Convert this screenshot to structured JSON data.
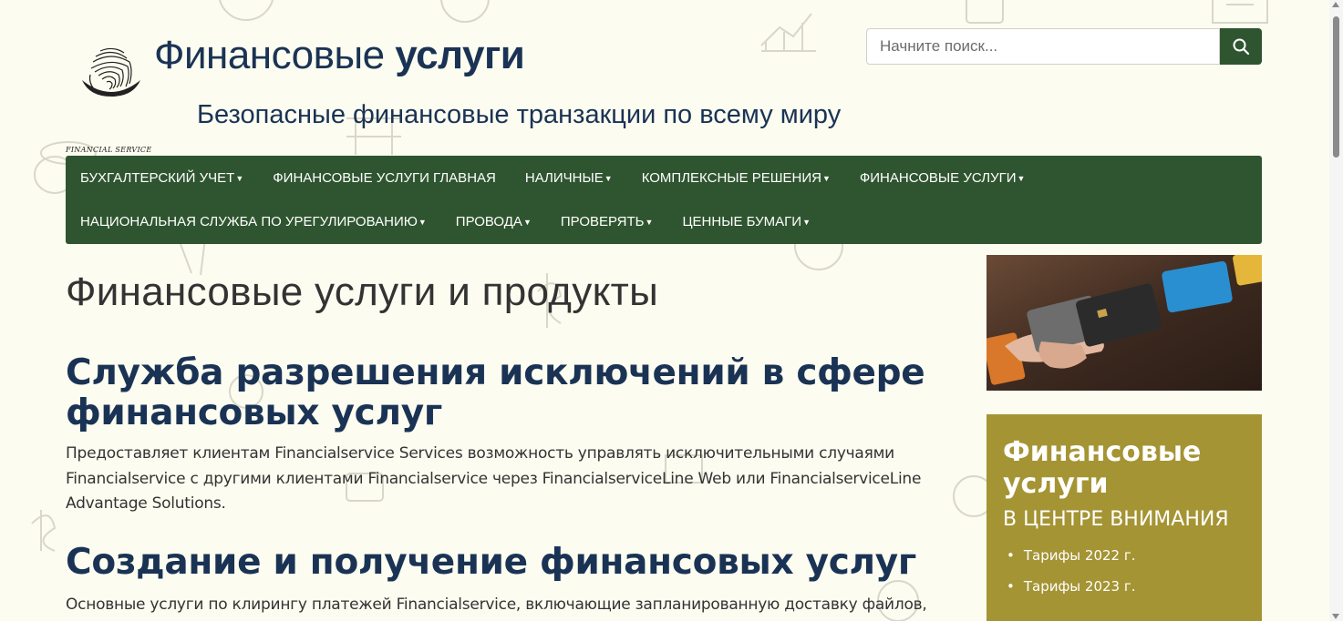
{
  "header": {
    "logo_caption": "FINANCIAL SERVICE",
    "title_regular": "Финансовые ",
    "title_bold": "услуги",
    "tagline": "Безопасные финансовые транзакции по всему миру"
  },
  "search": {
    "placeholder": "Начните поиск...",
    "icon": "search-icon"
  },
  "nav": {
    "row1": [
      {
        "label": "БУХГАЛТЕРСКИЙ УЧЕТ",
        "dropdown": true
      },
      {
        "label": "ФИНАНСОВЫЕ УСЛУГИ ГЛАВНАЯ",
        "dropdown": false
      },
      {
        "label": "НАЛИЧНЫЕ",
        "dropdown": true
      },
      {
        "label": "КОМПЛЕКСНЫЕ РЕШЕНИЯ",
        "dropdown": true
      },
      {
        "label": "ФИНАНСОВЫЕ УСЛУГИ",
        "dropdown": true
      }
    ],
    "row2": [
      {
        "label": "НАЦИОНАЛЬНАЯ СЛУЖБА ПО УРЕГУЛИРОВАНИЮ",
        "dropdown": true
      },
      {
        "label": "ПРОВОДА",
        "dropdown": true
      },
      {
        "label": "ПРОВЕРЯТЬ",
        "dropdown": true
      },
      {
        "label": "ЦЕННЫЕ БУМАГИ",
        "dropdown": true
      }
    ]
  },
  "main": {
    "title": "Финансовые услуги и продукты",
    "section1": {
      "heading": "Служба разрешения исключений в сфере финансовых услуг",
      "text": "Предоставляет клиентам Financialservice Services возможность управлять исключительными случаями Financialservice с другими клиентами Financialservice через FinancialserviceLine Web или FinancialserviceLine Advantage Solutions."
    },
    "section2": {
      "heading": "Создание и получение финансовых услуг",
      "text": "Основные услуги по клирингу платежей Financialservice, включающие запланированную доставку файлов,"
    }
  },
  "sidebar": {
    "box_title": "Финансовые услуги",
    "box_subtitle": "В ЦЕНТРЕ ВНИМАНИЯ",
    "links": [
      "Тарифы 2022 г.",
      "Тарифы 2023 г."
    ]
  },
  "colors": {
    "background": "#fcfcf0",
    "nav": "#2f5530",
    "heading": "#1a3355",
    "sidebar_box": "#a59434"
  }
}
